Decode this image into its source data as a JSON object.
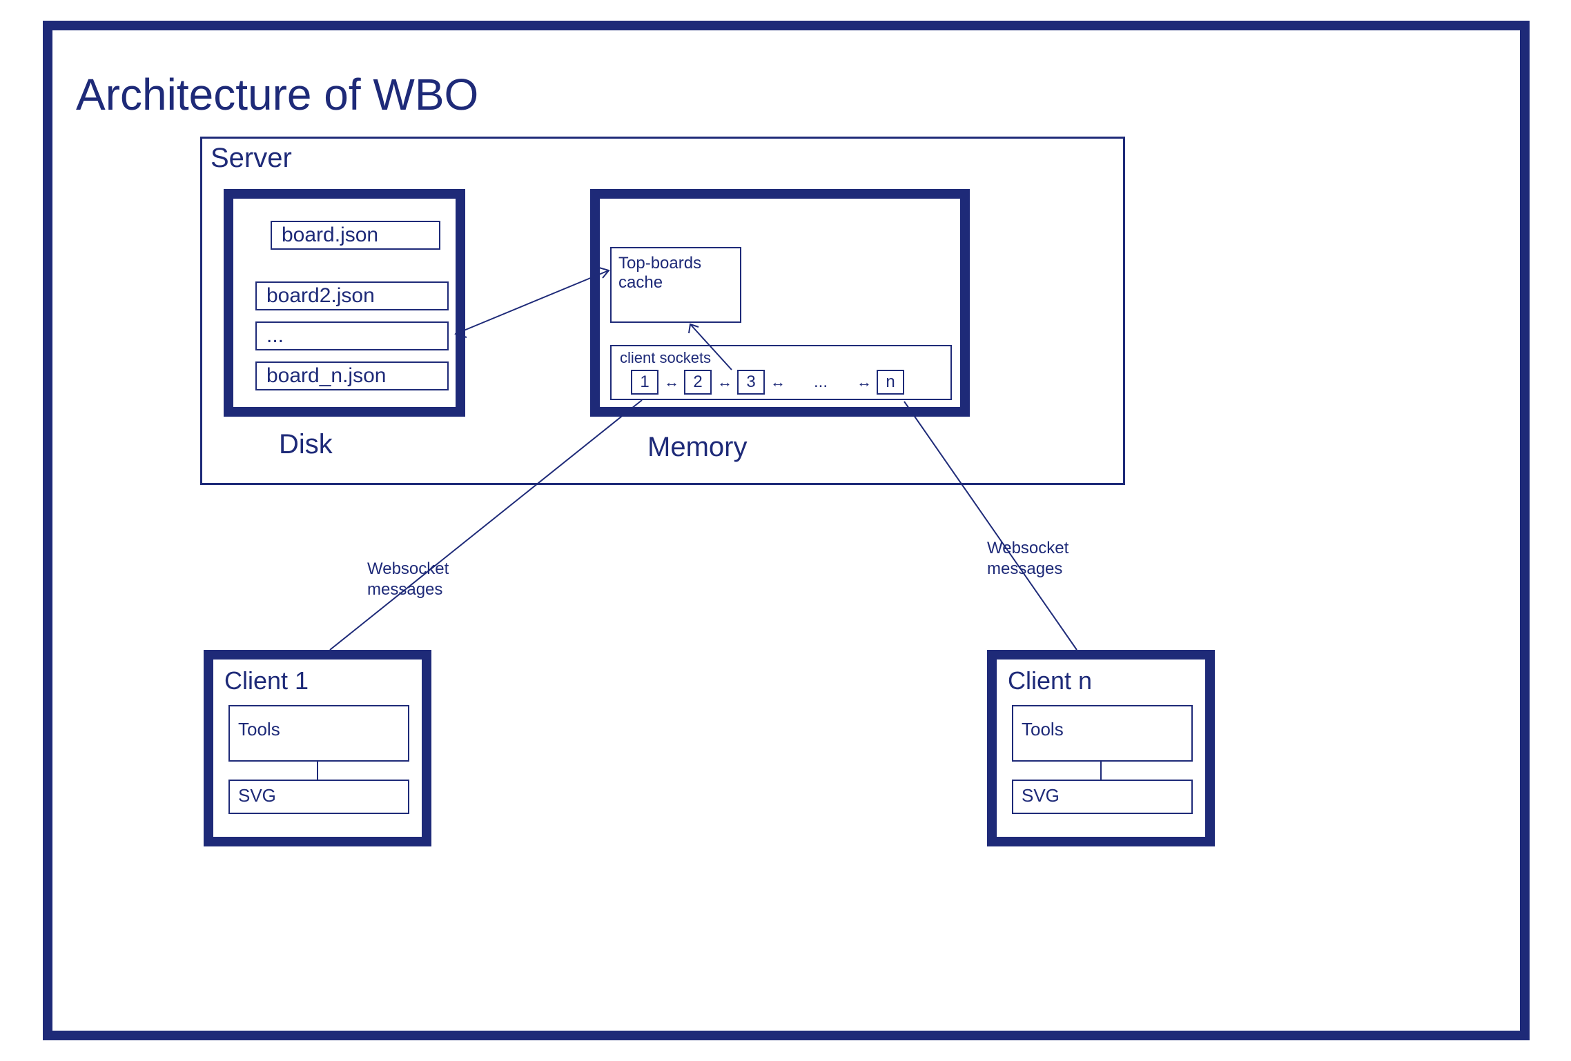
{
  "title": "Architecture of WBO",
  "server": {
    "title": "Server",
    "disk": {
      "label": "Disk",
      "items": [
        "board.json",
        "board2.json",
        "...",
        "board_n.json"
      ]
    },
    "memory": {
      "label": "Memory",
      "cache_label": "Top-boards cache",
      "sockets_label": "client sockets",
      "sockets": [
        "1",
        "2",
        "3"
      ],
      "sockets_ellipsis": "...",
      "sockets_last": "n",
      "bidi_arrow": "↔"
    }
  },
  "clients": {
    "client1": {
      "title": "Client 1",
      "tools": "Tools",
      "svg": "SVG"
    },
    "clientn": {
      "title": "Client n",
      "tools": "Tools",
      "svg": "SVG"
    }
  },
  "connections": {
    "ws1": "Websocket messages",
    "wsn": "Websocket messages"
  }
}
